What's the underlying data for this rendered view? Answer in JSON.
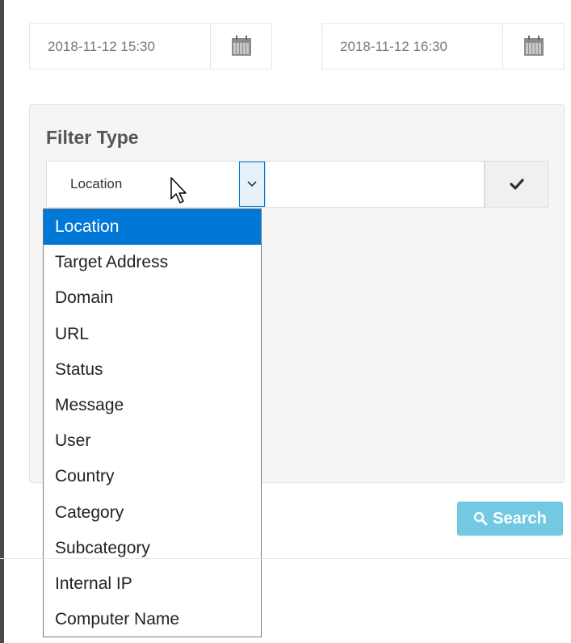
{
  "date_range": {
    "from": "2018-11-12 15:30",
    "to": "2018-11-12 16:30"
  },
  "filter": {
    "title": "Filter Type",
    "selected": "Location",
    "apply_icon": "check-icon",
    "options": [
      "Location",
      "Target Address",
      "Domain",
      "URL",
      "Status",
      "Message",
      "User",
      "Country",
      "Category",
      "Subcategory",
      "Internal IP",
      "Computer Name"
    ]
  },
  "search_button": {
    "label": "Search",
    "icon": "search-icon"
  },
  "colors": {
    "selected_option": "#0078d7",
    "search_button": "#5bc0de",
    "panel_bg": "#f5f5f5"
  }
}
